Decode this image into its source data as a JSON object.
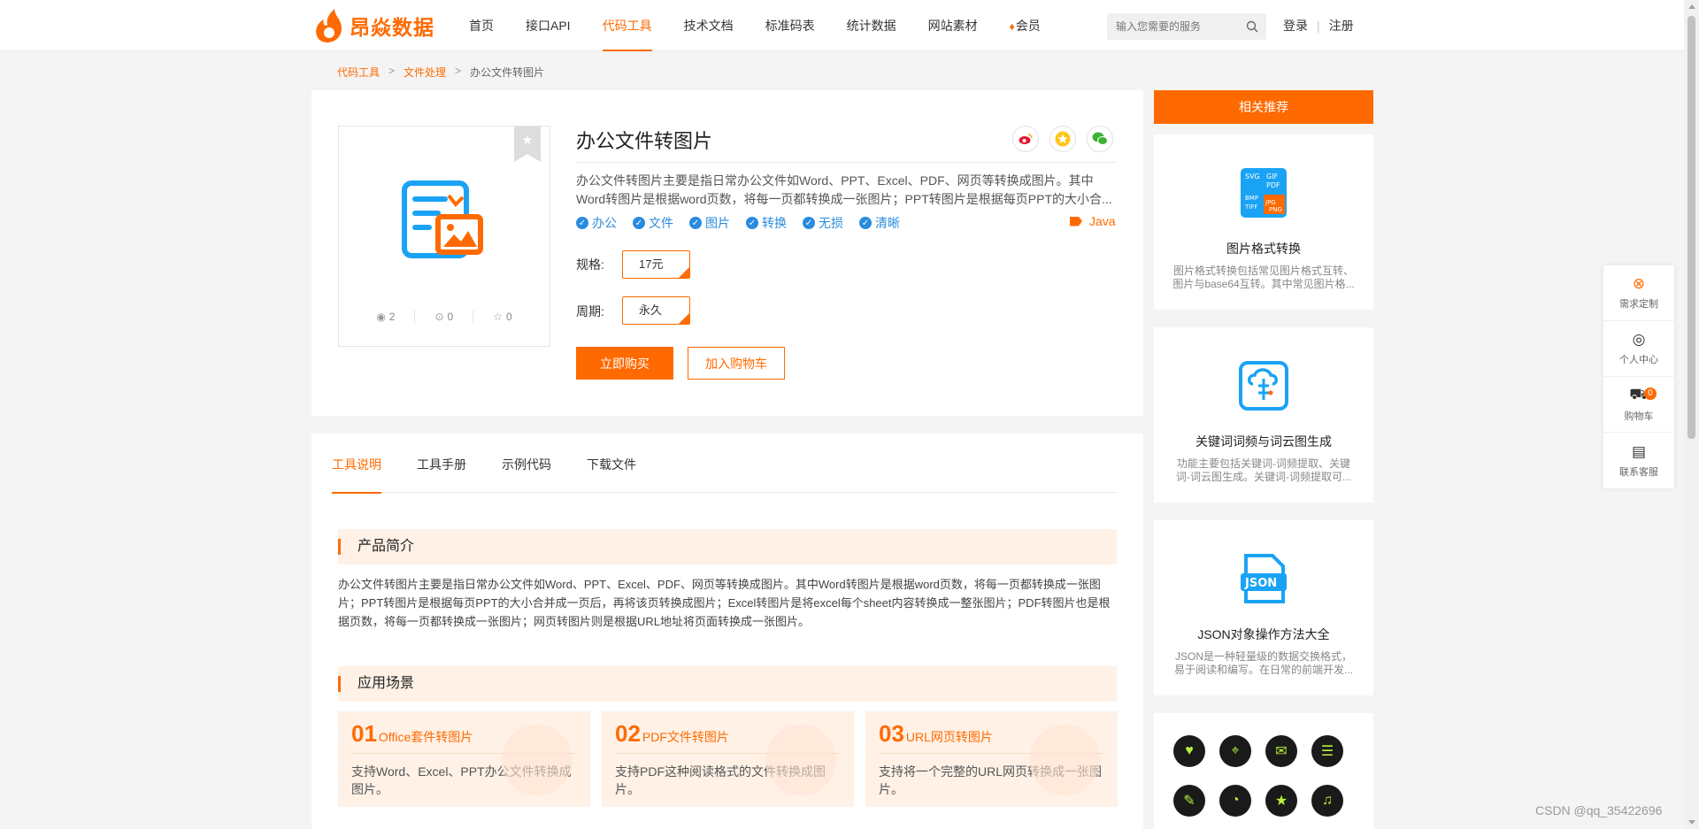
{
  "header": {
    "logo_text": "昂焱数据",
    "nav": [
      {
        "label": "首页",
        "active": false
      },
      {
        "label": "接口API",
        "active": false
      },
      {
        "label": "代码工具",
        "active": true
      },
      {
        "label": "技术文档",
        "active": false
      },
      {
        "label": "标准码表",
        "active": false
      },
      {
        "label": "统计数据",
        "active": false
      },
      {
        "label": "网站素材",
        "active": false
      },
      {
        "label": "会员",
        "active": false
      }
    ],
    "search_placeholder": "输入您需要的服务",
    "login": "登录",
    "register": "注册"
  },
  "breadcrumb": [
    "代码工具",
    "文件处理",
    "办公文件转图片"
  ],
  "product": {
    "title": "办公文件转图片",
    "description": "办公文件转图片主要是指日常办公文件如Word、PPT、Excel、PDF、网页等转换成图片。其中Word转图片是根据word页数，将每一页都转换成一张图片；PPT转图片是根据每页PPT的大小合...",
    "tags": [
      "办公",
      "文件",
      "图片",
      "转换",
      "无损",
      "清晰"
    ],
    "language": "Java",
    "spec_label": "规格:",
    "spec_value": "17元",
    "period_label": "周期:",
    "period_value": "永久",
    "buy_label": "立即购买",
    "cart_label": "加入购物车",
    "stats": {
      "views": "2",
      "downloads": "0",
      "favorites": "0"
    }
  },
  "tabs": [
    {
      "label": "工具说明",
      "active": true
    },
    {
      "label": "工具手册",
      "active": false
    },
    {
      "label": "示例代码",
      "active": false
    },
    {
      "label": "下载文件",
      "active": false
    }
  ],
  "intro_section": {
    "heading": "产品简介",
    "text": "办公文件转图片主要是指日常办公文件如Word、PPT、Excel、PDF、网页等转换成图片。其中Word转图片是根据word页数，将每一页都转换成一张图片；PPT转图片是根据每页PPT的大小合并成一页后，再将该页转换成图片；Excel转图片是将excel每个sheet内容转换成一整张图片；PDF转图片也是根据页数，将每一页都转换成一张图片；网页转图片则是根据URL地址将页面转换成一张图片。"
  },
  "scene_section": {
    "heading": "应用场景",
    "items": [
      {
        "num": "01",
        "title": "Office套件转图片",
        "desc": "支持Word、Excel、PPT办公文件转换成图片。"
      },
      {
        "num": "02",
        "title": "PDF文件转图片",
        "desc": "支持PDF这种阅读格式的文件转换成图片。"
      },
      {
        "num": "03",
        "title": "URL网页转图片",
        "desc": "支持将一个完整的URL网页转换成一张图片。"
      }
    ]
  },
  "sidebar": {
    "heading": "相关推荐",
    "cards": [
      {
        "title": "图片格式转换",
        "desc": "图片格式转换包括常见图片格式互转、图片与base64互转。其中常见图片格..."
      },
      {
        "title": "关键词词频与词云图生成",
        "desc": "功能主要包括关键词-词频提取、关键词-词云图生成。关键词-词频提取可..."
      },
      {
        "title": "JSON对象操作方法大全",
        "desc": "JSON是一种轻量级的数据交换格式，易于阅读和编写。在日常的前端开发..."
      }
    ]
  },
  "float_bar": {
    "items": [
      "需求定制",
      "个人中心",
      "购物车",
      "联系客服"
    ],
    "cart_count": "0"
  },
  "watermark": "CSDN @qq_35422696",
  "colors": {
    "accent": "#ff6a00",
    "tag_blue": "#2a8cde"
  }
}
